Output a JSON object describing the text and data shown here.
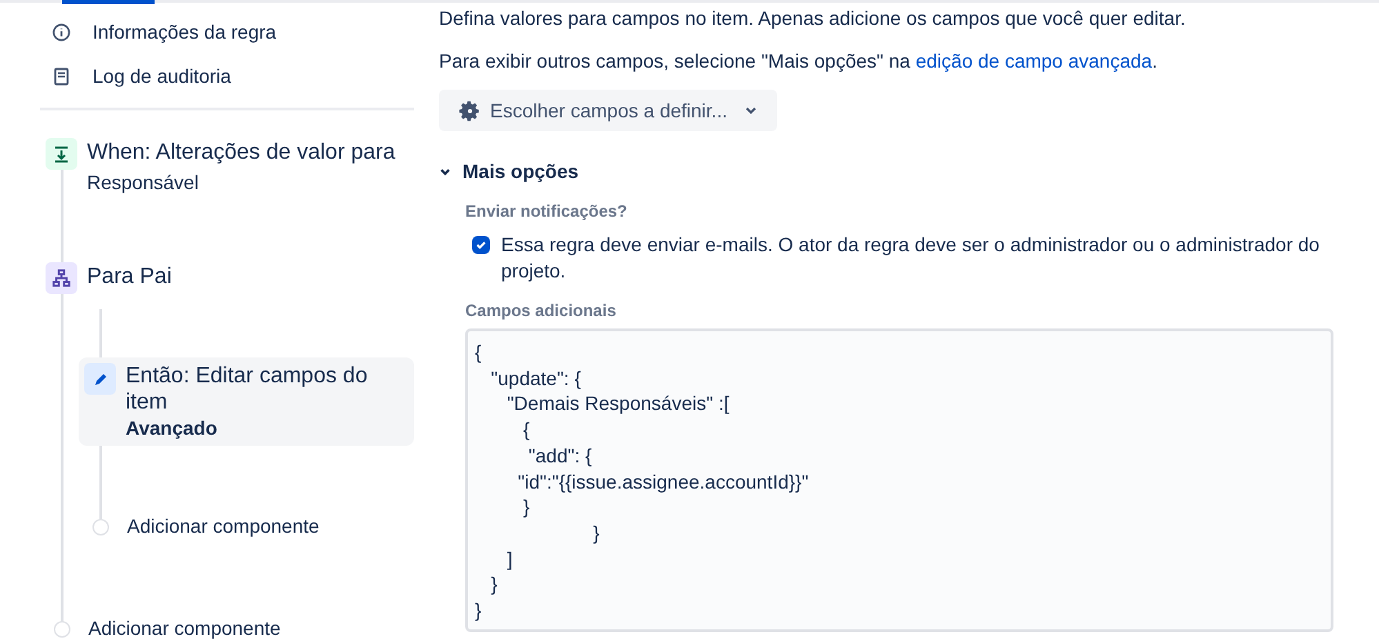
{
  "nav_items": [
    {
      "kind": "info",
      "label": "Informações da regra"
    },
    {
      "kind": "log",
      "label": "Log de auditoria"
    }
  ],
  "trigger": {
    "title": "When: Alterações de valor para",
    "subtitle": "Responsável"
  },
  "branch": {
    "title": "Para Pai"
  },
  "action": {
    "title": "Então: Editar campos do item",
    "subtitle": "Avançado",
    "selected": true
  },
  "inner_add": "Adicionar componente",
  "outer_add": "Adicionar componente",
  "intro": "Defina valores para campos no item. Apenas adicione os campos que você quer editar.",
  "hint": {
    "before": "Para exibir outros campos, selecione \"Mais opções\" na ",
    "link": "edição de campo avançada",
    "after": "."
  },
  "choose_button": "Escolher campos a definir...",
  "more_options": {
    "label": "Mais opções",
    "expanded": true
  },
  "notifications": {
    "label": "Enviar notificações?",
    "text": "Essa regra deve enviar e-mails. O ator da regra deve ser o administrador ou o administrador do projeto.",
    "checked": true
  },
  "additional_fields": {
    "label": "Campos adicionais",
    "lines": [
      "{",
      "   \"update\": {",
      "      \"Demais Responsáveis\" :[",
      "         {",
      "          \"add\": {",
      "        \"id\":\"{{issue.assignee.accountId}}\"",
      "         }",
      "                      }",
      "      ]",
      "   }",
      "}"
    ]
  }
}
